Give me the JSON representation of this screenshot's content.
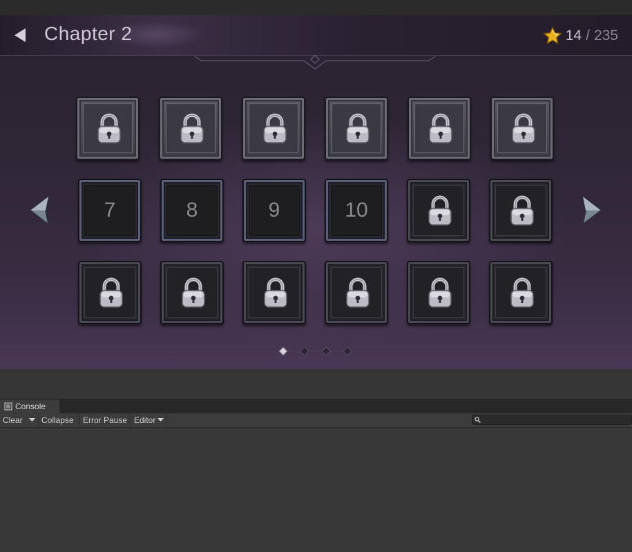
{
  "game": {
    "chapter_title": "Chapter 2",
    "stars_current": "14",
    "stars_separator": "/",
    "stars_total": "235",
    "back_icon": "back-arrow-icon",
    "star_icon": "star-icon",
    "lock_icon": "padlock-icon",
    "levels": [
      {
        "label": "",
        "state": "locked"
      },
      {
        "label": "",
        "state": "locked"
      },
      {
        "label": "",
        "state": "locked"
      },
      {
        "label": "",
        "state": "locked"
      },
      {
        "label": "",
        "state": "locked"
      },
      {
        "label": "",
        "state": "locked"
      },
      {
        "label": "7",
        "state": "open"
      },
      {
        "label": "8",
        "state": "open"
      },
      {
        "label": "9",
        "state": "open"
      },
      {
        "label": "10",
        "state": "open"
      },
      {
        "label": "",
        "state": "locked"
      },
      {
        "label": "",
        "state": "locked"
      },
      {
        "label": "",
        "state": "locked"
      },
      {
        "label": "",
        "state": "locked"
      },
      {
        "label": "",
        "state": "locked"
      },
      {
        "label": "",
        "state": "locked"
      },
      {
        "label": "",
        "state": "locked"
      },
      {
        "label": "",
        "state": "locked"
      }
    ],
    "pager": {
      "pages": 4,
      "current_page": 1
    },
    "colors": {
      "star": "#e8b021",
      "background": "#2f2636"
    }
  },
  "console": {
    "tab_label": "Console",
    "toolbar": {
      "clear": "Clear",
      "collapse": "Collapse",
      "error_pause": "Error Pause",
      "editor": "Editor"
    },
    "search_placeholder": ""
  }
}
